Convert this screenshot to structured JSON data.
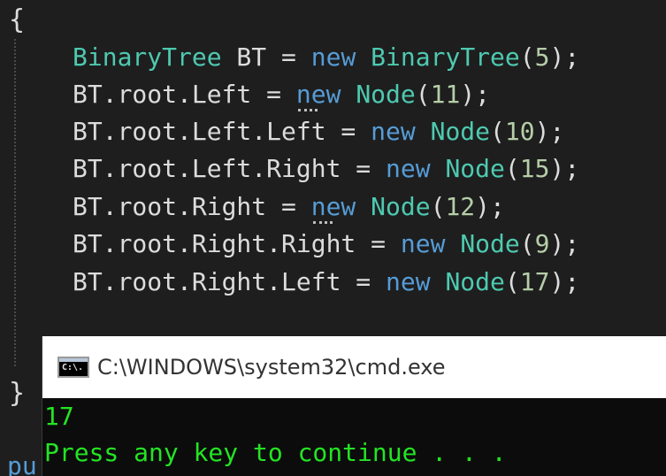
{
  "editor": {
    "open_brace": "{",
    "close_brace": "}",
    "partial_next_line": "pu",
    "lines": [
      [
        {
          "t": "BinaryTree",
          "c": "type"
        },
        {
          "t": " BT = ",
          "c": "plain"
        },
        {
          "t": "new",
          "c": "kw"
        },
        {
          "t": " ",
          "c": "plain"
        },
        {
          "t": "BinaryTree",
          "c": "type"
        },
        {
          "t": "(",
          "c": "plain"
        },
        {
          "t": "5",
          "c": "num"
        },
        {
          "t": ");",
          "c": "plain"
        }
      ],
      [
        {
          "t": "BT.root.Left = ",
          "c": "plain"
        },
        {
          "t": "new",
          "c": "kw",
          "hint": true
        },
        {
          "t": " ",
          "c": "plain"
        },
        {
          "t": "Node",
          "c": "type"
        },
        {
          "t": "(",
          "c": "plain"
        },
        {
          "t": "11",
          "c": "num"
        },
        {
          "t": ");",
          "c": "plain"
        }
      ],
      [
        {
          "t": "BT.root.Left.Left = ",
          "c": "plain"
        },
        {
          "t": "new",
          "c": "kw"
        },
        {
          "t": " ",
          "c": "plain"
        },
        {
          "t": "Node",
          "c": "type"
        },
        {
          "t": "(",
          "c": "plain"
        },
        {
          "t": "10",
          "c": "num"
        },
        {
          "t": ");",
          "c": "plain"
        }
      ],
      [
        {
          "t": "BT.root.Left.Right = ",
          "c": "plain"
        },
        {
          "t": "new",
          "c": "kw"
        },
        {
          "t": " ",
          "c": "plain"
        },
        {
          "t": "Node",
          "c": "type"
        },
        {
          "t": "(",
          "c": "plain"
        },
        {
          "t": "15",
          "c": "num"
        },
        {
          "t": ");",
          "c": "plain"
        }
      ],
      [
        {
          "t": "BT.root.Right = ",
          "c": "plain"
        },
        {
          "t": "new",
          "c": "kw",
          "hint": true
        },
        {
          "t": " ",
          "c": "plain"
        },
        {
          "t": "Node",
          "c": "type"
        },
        {
          "t": "(",
          "c": "plain"
        },
        {
          "t": "12",
          "c": "num"
        },
        {
          "t": ");",
          "c": "plain"
        }
      ],
      [
        {
          "t": "BT.root.Right.Right = ",
          "c": "plain"
        },
        {
          "t": "new",
          "c": "kw"
        },
        {
          "t": " ",
          "c": "plain"
        },
        {
          "t": "Node",
          "c": "type"
        },
        {
          "t": "(",
          "c": "plain"
        },
        {
          "t": "9",
          "c": "num"
        },
        {
          "t": ");",
          "c": "plain"
        }
      ],
      [
        {
          "t": "BT.root.Right.Left = ",
          "c": "plain"
        },
        {
          "t": "new",
          "c": "kw"
        },
        {
          "t": " ",
          "c": "plain"
        },
        {
          "t": "Node",
          "c": "type"
        },
        {
          "t": "(",
          "c": "plain"
        },
        {
          "t": "17",
          "c": "num"
        },
        {
          "t": ");",
          "c": "plain"
        }
      ]
    ]
  },
  "console": {
    "title": "C:\\WINDOWS\\system32\\cmd.exe",
    "icon_label": "C:\\.",
    "icon": "cmd-icon",
    "output": [
      "17",
      "Press any key to continue . . ."
    ]
  },
  "colors": {
    "background": "#1e1e1e",
    "type": "#4ec9b0",
    "keyword": "#569cd6",
    "number": "#b5cea8",
    "text": "#dcdcdc",
    "console_text": "#23e423"
  }
}
